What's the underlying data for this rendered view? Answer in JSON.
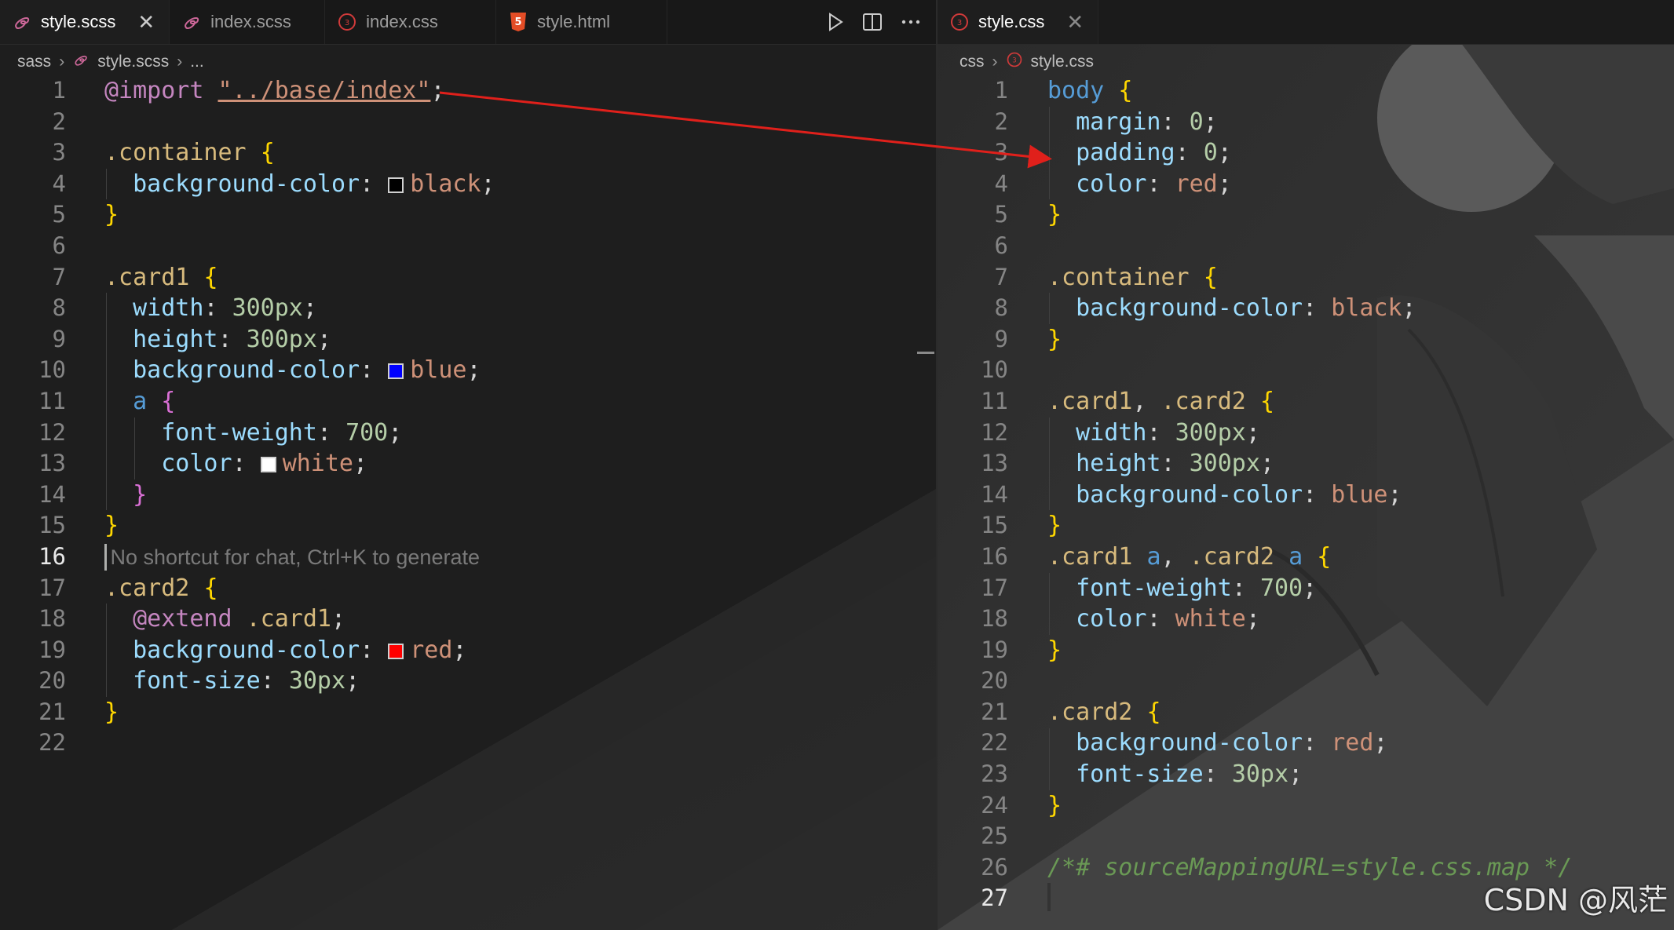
{
  "left_editor": {
    "tabs": [
      {
        "label": "style.scss",
        "icon": "sass-icon",
        "active": true,
        "close": "✕"
      },
      {
        "label": "index.scss",
        "icon": "sass-icon",
        "active": false
      },
      {
        "label": "index.css",
        "icon": "css-icon",
        "active": false
      },
      {
        "label": "style.html",
        "icon": "html5-icon",
        "active": false
      }
    ],
    "actions": [
      "run-icon",
      "split-editor-icon",
      "more-actions-icon"
    ],
    "breadcrumb": {
      "folder": "sass",
      "file": "style.scss",
      "rest": "..."
    },
    "lines": [
      {
        "n": "1",
        "tokens": [
          [
            "kw",
            "@import"
          ],
          [
            "plain",
            " "
          ],
          [
            "str",
            "\"../base/index\""
          ],
          [
            "plain",
            ";"
          ]
        ]
      },
      {
        "n": "2",
        "tokens": []
      },
      {
        "n": "3",
        "tokens": [
          [
            "sel",
            ".container"
          ],
          [
            "plain",
            " "
          ],
          [
            "br",
            "{"
          ]
        ]
      },
      {
        "n": "4",
        "tokens": [
          [
            "plain",
            "  "
          ],
          [
            "prop",
            "background-color"
          ],
          [
            "plain",
            ": "
          ],
          [
            "swatch",
            "#000000"
          ],
          [
            "val",
            "black"
          ],
          [
            "plain",
            ";"
          ]
        ]
      },
      {
        "n": "5",
        "tokens": [
          [
            "br",
            "}"
          ]
        ]
      },
      {
        "n": "6",
        "tokens": []
      },
      {
        "n": "7",
        "tokens": [
          [
            "sel",
            ".card1"
          ],
          [
            "plain",
            " "
          ],
          [
            "br",
            "{"
          ]
        ]
      },
      {
        "n": "8",
        "tokens": [
          [
            "plain",
            "  "
          ],
          [
            "prop",
            "width"
          ],
          [
            "plain",
            ": "
          ],
          [
            "num",
            "300px"
          ],
          [
            "plain",
            ";"
          ]
        ]
      },
      {
        "n": "9",
        "tokens": [
          [
            "plain",
            "  "
          ],
          [
            "prop",
            "height"
          ],
          [
            "plain",
            ": "
          ],
          [
            "num",
            "300px"
          ],
          [
            "plain",
            ";"
          ]
        ]
      },
      {
        "n": "10",
        "tokens": [
          [
            "plain",
            "  "
          ],
          [
            "prop",
            "background-color"
          ],
          [
            "plain",
            ": "
          ],
          [
            "swatch",
            "#0000ff"
          ],
          [
            "val",
            "blue"
          ],
          [
            "plain",
            ";"
          ]
        ]
      },
      {
        "n": "11",
        "tokens": [
          [
            "plain",
            "  "
          ],
          [
            "tag",
            "a"
          ],
          [
            "plain",
            " "
          ],
          [
            "br2",
            "{"
          ]
        ]
      },
      {
        "n": "12",
        "tokens": [
          [
            "plain",
            "    "
          ],
          [
            "prop",
            "font-weight"
          ],
          [
            "plain",
            ": "
          ],
          [
            "num",
            "700"
          ],
          [
            "plain",
            ";"
          ]
        ]
      },
      {
        "n": "13",
        "tokens": [
          [
            "plain",
            "    "
          ],
          [
            "prop",
            "color"
          ],
          [
            "plain",
            ": "
          ],
          [
            "swatch",
            "#ffffff"
          ],
          [
            "val",
            "white"
          ],
          [
            "plain",
            ";"
          ]
        ]
      },
      {
        "n": "14",
        "tokens": [
          [
            "plain",
            "  "
          ],
          [
            "br2",
            "}"
          ]
        ]
      },
      {
        "n": "15",
        "tokens": [
          [
            "br",
            "}"
          ]
        ]
      },
      {
        "n": "16",
        "current": true,
        "tokens": [
          [
            "hint",
            " No shortcut for chat, Ctrl+K to generate"
          ]
        ]
      },
      {
        "n": "17",
        "tokens": [
          [
            "sel",
            ".card2"
          ],
          [
            "plain",
            " "
          ],
          [
            "br",
            "{"
          ]
        ]
      },
      {
        "n": "18",
        "tokens": [
          [
            "plain",
            "  "
          ],
          [
            "kw",
            "@extend"
          ],
          [
            "plain",
            " "
          ],
          [
            "sel",
            ".card1"
          ],
          [
            "plain",
            ";"
          ]
        ]
      },
      {
        "n": "19",
        "tokens": [
          [
            "plain",
            "  "
          ],
          [
            "prop",
            "background-color"
          ],
          [
            "plain",
            ": "
          ],
          [
            "swatch",
            "#ff0000"
          ],
          [
            "val",
            "red"
          ],
          [
            "plain",
            ";"
          ]
        ]
      },
      {
        "n": "20",
        "tokens": [
          [
            "plain",
            "  "
          ],
          [
            "prop",
            "font-size"
          ],
          [
            "plain",
            ": "
          ],
          [
            "num",
            "30px"
          ],
          [
            "plain",
            ";"
          ]
        ]
      },
      {
        "n": "21",
        "tokens": [
          [
            "br",
            "}"
          ]
        ]
      },
      {
        "n": "22",
        "tokens": []
      }
    ]
  },
  "right_editor": {
    "tabs": [
      {
        "label": "style.css",
        "icon": "css-icon",
        "active": true,
        "close": "✕"
      }
    ],
    "breadcrumb": {
      "folder": "css",
      "file": "style.css"
    },
    "lines": [
      {
        "n": "1",
        "tokens": [
          [
            "tag",
            "body"
          ],
          [
            "plain",
            " "
          ],
          [
            "br",
            "{"
          ]
        ]
      },
      {
        "n": "2",
        "tokens": [
          [
            "plain",
            "  "
          ],
          [
            "prop",
            "margin"
          ],
          [
            "plain",
            ": "
          ],
          [
            "num",
            "0"
          ],
          [
            "plain",
            ";"
          ]
        ]
      },
      {
        "n": "3",
        "tokens": [
          [
            "plain",
            "  "
          ],
          [
            "prop",
            "padding"
          ],
          [
            "plain",
            ": "
          ],
          [
            "num",
            "0"
          ],
          [
            "plain",
            ";"
          ]
        ]
      },
      {
        "n": "4",
        "tokens": [
          [
            "plain",
            "  "
          ],
          [
            "prop",
            "color"
          ],
          [
            "plain",
            ": "
          ],
          [
            "val",
            "red"
          ],
          [
            "plain",
            ";"
          ]
        ]
      },
      {
        "n": "5",
        "tokens": [
          [
            "br",
            "}"
          ]
        ]
      },
      {
        "n": "6",
        "tokens": []
      },
      {
        "n": "7",
        "tokens": [
          [
            "sel",
            ".container"
          ],
          [
            "plain",
            " "
          ],
          [
            "br",
            "{"
          ]
        ]
      },
      {
        "n": "8",
        "tokens": [
          [
            "plain",
            "  "
          ],
          [
            "prop",
            "background-color"
          ],
          [
            "plain",
            ": "
          ],
          [
            "val",
            "black"
          ],
          [
            "plain",
            ";"
          ]
        ]
      },
      {
        "n": "9",
        "tokens": [
          [
            "br",
            "}"
          ]
        ]
      },
      {
        "n": "10",
        "tokens": []
      },
      {
        "n": "11",
        "tokens": [
          [
            "sel",
            ".card1"
          ],
          [
            "plain",
            ", "
          ],
          [
            "sel",
            ".card2"
          ],
          [
            "plain",
            " "
          ],
          [
            "br",
            "{"
          ]
        ]
      },
      {
        "n": "12",
        "tokens": [
          [
            "plain",
            "  "
          ],
          [
            "prop",
            "width"
          ],
          [
            "plain",
            ": "
          ],
          [
            "num",
            "300px"
          ],
          [
            "plain",
            ";"
          ]
        ]
      },
      {
        "n": "13",
        "tokens": [
          [
            "plain",
            "  "
          ],
          [
            "prop",
            "height"
          ],
          [
            "plain",
            ": "
          ],
          [
            "num",
            "300px"
          ],
          [
            "plain",
            ";"
          ]
        ]
      },
      {
        "n": "14",
        "tokens": [
          [
            "plain",
            "  "
          ],
          [
            "prop",
            "background-color"
          ],
          [
            "plain",
            ": "
          ],
          [
            "val",
            "blue"
          ],
          [
            "plain",
            ";"
          ]
        ]
      },
      {
        "n": "15",
        "tokens": [
          [
            "br",
            "}"
          ]
        ]
      },
      {
        "n": "16",
        "tokens": [
          [
            "sel",
            ".card1"
          ],
          [
            "plain",
            " "
          ],
          [
            "tag",
            "a"
          ],
          [
            "plain",
            ", "
          ],
          [
            "sel",
            ".card2"
          ],
          [
            "plain",
            " "
          ],
          [
            "tag",
            "a"
          ],
          [
            "plain",
            " "
          ],
          [
            "br",
            "{"
          ]
        ]
      },
      {
        "n": "17",
        "tokens": [
          [
            "plain",
            "  "
          ],
          [
            "prop",
            "font-weight"
          ],
          [
            "plain",
            ": "
          ],
          [
            "num",
            "700"
          ],
          [
            "plain",
            ";"
          ]
        ]
      },
      {
        "n": "18",
        "tokens": [
          [
            "plain",
            "  "
          ],
          [
            "prop",
            "color"
          ],
          [
            "plain",
            ": "
          ],
          [
            "val",
            "white"
          ],
          [
            "plain",
            ";"
          ]
        ]
      },
      {
        "n": "19",
        "tokens": [
          [
            "br",
            "}"
          ]
        ]
      },
      {
        "n": "20",
        "tokens": []
      },
      {
        "n": "21",
        "tokens": [
          [
            "sel",
            ".card2"
          ],
          [
            "plain",
            " "
          ],
          [
            "br",
            "{"
          ]
        ]
      },
      {
        "n": "22",
        "tokens": [
          [
            "plain",
            "  "
          ],
          [
            "prop",
            "background-color"
          ],
          [
            "plain",
            ": "
          ],
          [
            "val",
            "red"
          ],
          [
            "plain",
            ";"
          ]
        ]
      },
      {
        "n": "23",
        "tokens": [
          [
            "plain",
            "  "
          ],
          [
            "prop",
            "font-size"
          ],
          [
            "plain",
            ": "
          ],
          [
            "num",
            "30px"
          ],
          [
            "plain",
            ";"
          ]
        ]
      },
      {
        "n": "24",
        "tokens": [
          [
            "br",
            "}"
          ]
        ]
      },
      {
        "n": "25",
        "tokens": []
      },
      {
        "n": "26",
        "tokens": [
          [
            "com",
            "/*# sourceMappingURL=style.css.map */"
          ]
        ]
      },
      {
        "n": "27",
        "current": true,
        "tokens": []
      }
    ]
  },
  "watermark": "CSDN @风茫",
  "colors": {
    "arrow": "#e0201b",
    "editor_bg": "#1e1e1e",
    "string": "#ce9178",
    "property": "#9cdcfe",
    "selector": "#d7ba7d",
    "bracket": "#ffd700"
  }
}
